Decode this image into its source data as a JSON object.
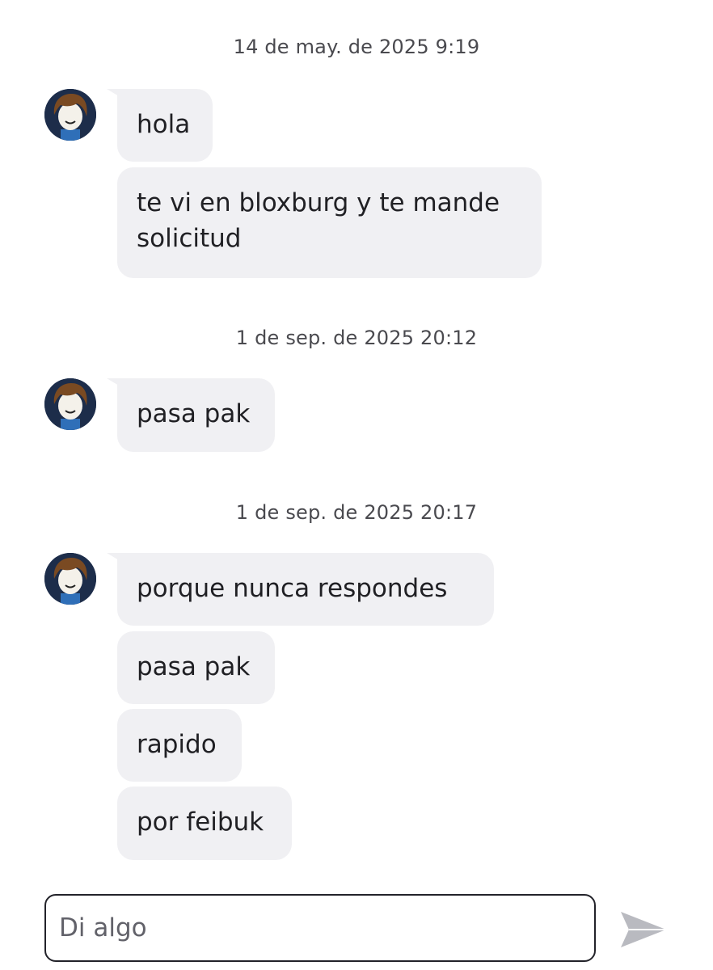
{
  "conversation": {
    "groups": [
      {
        "timestamp": "14 de may. de 2025 9:19",
        "messages": [
          "hola",
          "te vi en bloxburg y te mande solicitud"
        ]
      },
      {
        "timestamp": "1 de sep. de 2025 20:12",
        "messages": [
          "pasa pak"
        ]
      },
      {
        "timestamp": "1 de sep. de 2025 20:17",
        "messages": [
          "porque nunca respondes",
          "pasa pak",
          "rapido",
          "por feibuk"
        ]
      }
    ]
  },
  "composer": {
    "placeholder": "Di algo"
  },
  "icons": {
    "avatar": "roblox-avatar-icon",
    "send": "send-arrow-icon"
  },
  "colors": {
    "bubble": "#f0f0f3",
    "timestamp": "#4a4a4f",
    "send_icon": "#b9bac0"
  }
}
